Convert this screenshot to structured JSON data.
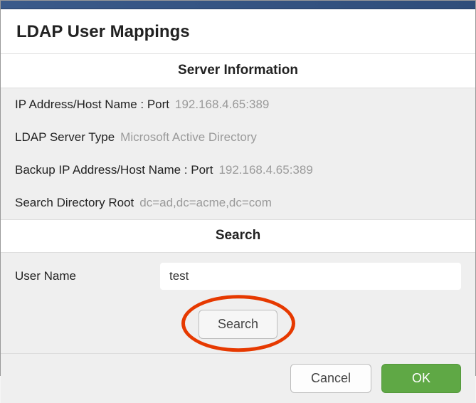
{
  "dialog": {
    "title": "LDAP User Mappings"
  },
  "server_info": {
    "header": "Server Information",
    "ip_label": "IP Address/Host Name : Port",
    "ip_value": "192.168.4.65:389",
    "type_label": "LDAP Server Type",
    "type_value": "Microsoft Active Directory",
    "backup_label": "Backup IP Address/Host Name : Port",
    "backup_value": "192.168.4.65:389",
    "root_label": "Search Directory Root",
    "root_value": "dc=ad,dc=acme,dc=com"
  },
  "search": {
    "header": "Search",
    "username_label": "User Name",
    "username_value": "test",
    "button_label": "Search"
  },
  "footer": {
    "cancel_label": "Cancel",
    "ok_label": "OK"
  },
  "colors": {
    "ok_bg": "#5fa845",
    "annotation": "#e63900"
  }
}
